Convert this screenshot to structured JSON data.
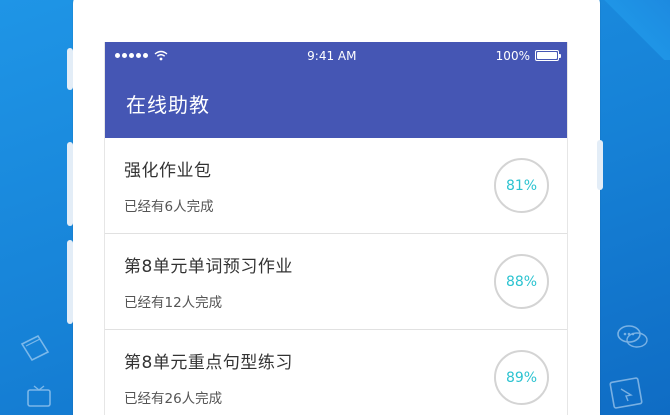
{
  "status_bar": {
    "time": "9:41 AM",
    "battery": "100%"
  },
  "nav": {
    "title": "在线助教"
  },
  "assignments": [
    {
      "title": "强化作业包",
      "subtitle": "已经有6人完成",
      "percent": "81%"
    },
    {
      "title": "第8单元单词预习作业",
      "subtitle": "已经有12人完成",
      "percent": "88%"
    },
    {
      "title": "第8单元重点句型练习",
      "subtitle": "已经有26人完成",
      "percent": "89%"
    }
  ],
  "colors": {
    "header": "#4556b4",
    "accent": "#2cc3d0",
    "background": "#1f8ee0"
  },
  "background_icons": [
    "book-icon",
    "tv-icon",
    "chat-bubbles-icon",
    "cursor-screen-icon"
  ]
}
